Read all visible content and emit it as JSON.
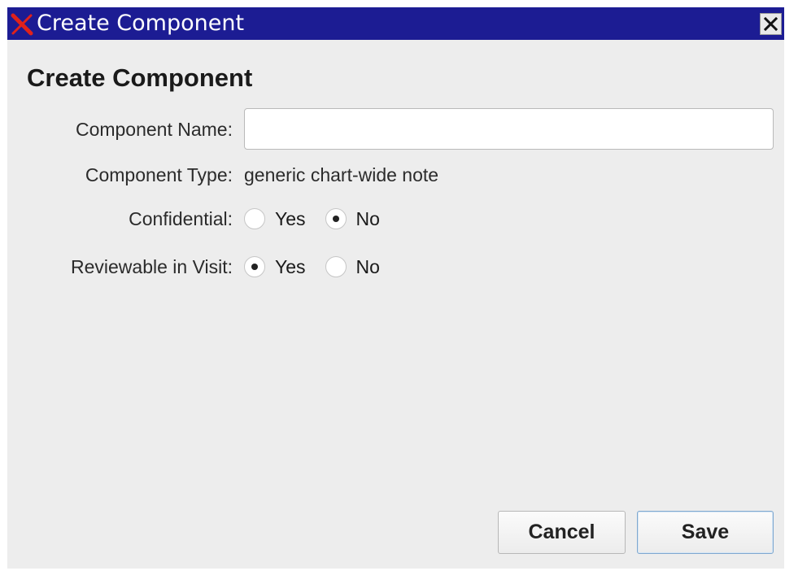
{
  "window": {
    "title": "Create Component",
    "close_symbol": "×",
    "app_icon": "red-x-app-icon",
    "titlebar_color": "#1c1c93"
  },
  "form": {
    "heading": "Create Component",
    "name_label": "Component Name:",
    "name_value": "",
    "name_placeholder": "",
    "type_label": "Component Type:",
    "type_value": "generic chart-wide note",
    "confidential": {
      "label": "Confidential:",
      "options": [
        "Yes",
        "No"
      ],
      "selected": "No"
    },
    "reviewable": {
      "label": "Reviewable in Visit:",
      "options": [
        "Yes",
        "No"
      ],
      "selected": "Yes"
    }
  },
  "buttons": {
    "cancel_label": "Cancel",
    "save_label": "Save",
    "save_border_color": "#7fa8cf"
  }
}
